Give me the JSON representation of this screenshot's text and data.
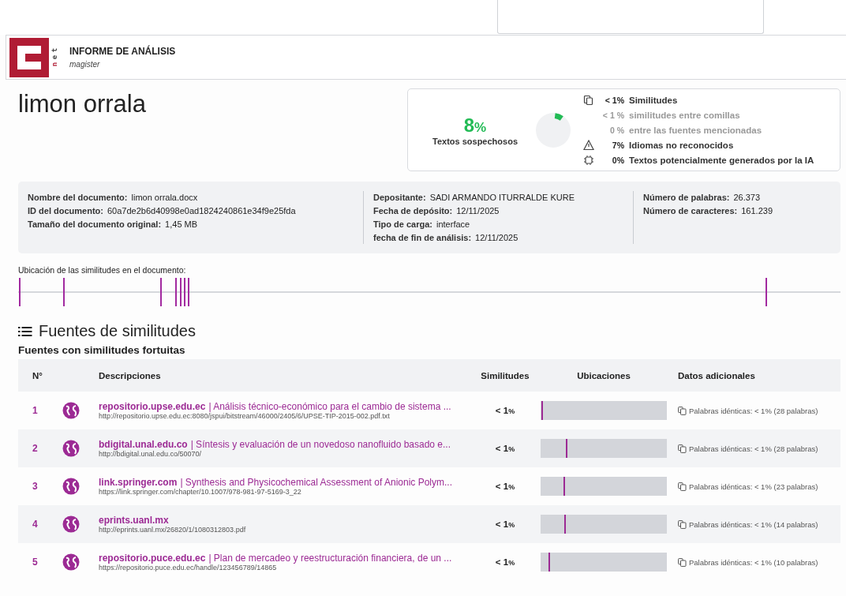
{
  "header": {
    "title": "INFORME DE ANÁLISIS",
    "subtitle": "magister",
    "logo_letters": "net"
  },
  "document_title": "limon orrala",
  "summary": {
    "percent": "8",
    "percent_sign": "%",
    "label": "Textos sospechosos",
    "lines": [
      {
        "kind": "similarity",
        "value": "< 1%",
        "label": "Similitudes"
      },
      {
        "kind": "sub",
        "value": "< 1 %",
        "label": "similitudes entre comillas"
      },
      {
        "kind": "sub",
        "value": "0 %",
        "label": "entre las fuentes mencionadas"
      },
      {
        "kind": "language",
        "value": "7%",
        "label": "Idiomas no reconocidos"
      },
      {
        "kind": "ai",
        "value": "0%",
        "label": "Textos potencialmente generados por la IA"
      }
    ]
  },
  "details": [
    [
      {
        "label": "Nombre del documento:",
        "value": "limon orrala.docx"
      },
      {
        "label": "ID del documento:",
        "value": "60a7de2b6d40998e0ad1824240861e34f9e25fda"
      },
      {
        "label": "Tamaño del documento original:",
        "value": "1,45 MB"
      }
    ],
    [
      {
        "label": "Depositante:",
        "value": "SADI ARMANDO ITURRALDE KURE"
      },
      {
        "label": "Fecha de depósito:",
        "value": "12/11/2025"
      },
      {
        "label": "Tipo de carga:",
        "value": "interface"
      },
      {
        "label": "fecha de fin de análisis:",
        "value": "12/11/2025"
      }
    ],
    [
      {
        "label": "Número de palabras:",
        "value": "26.373"
      },
      {
        "label": "Número de caracteres:",
        "value": "161.239"
      }
    ]
  ],
  "locations": {
    "title": "Ubicación de las similitudes en el documento:",
    "markers": [
      {
        "level": 0.001
      },
      {
        "level": 0.055
      },
      {
        "level": 0.173
      },
      {
        "level": 0.191
      },
      {
        "level": 0.197
      },
      {
        "level": 0.202
      },
      {
        "level": 0.206
      },
      {
        "level": 0.909
      }
    ]
  },
  "sources": {
    "title": "Fuentes de similitudes",
    "subtitle": "Fuentes con similitudes fortuitas",
    "columns": [
      "N°",
      "Descripciones",
      "Similitudes",
      "Ubicaciones",
      "Datos adicionales"
    ],
    "rows": [
      {
        "number": "1",
        "site": "repositorio.upse.edu.ec",
        "description": "| Análisis técnico-económico para el cambio de sistema ...",
        "url": "http://repositorio.upse.edu.ec:8080/jspui/bitstream/46000/2405/6/UPSE-TIP-2015-002.pdf.txt",
        "similarity": "< 1",
        "sim_sign": "%",
        "location": {
          "level": 0.005
        },
        "extra": "Palabras idénticas: < 1% (28 palabras)"
      },
      {
        "number": "2",
        "site": "bdigital.unal.edu.co",
        "description": "| Síntesis y evaluación de un novedoso nanofluido basado e...",
        "url": "http://bdigital.unal.edu.co/50070/",
        "similarity": "< 1",
        "sim_sign": "%",
        "location": {
          "level": 0.2
        },
        "extra": "Palabras idénticas: < 1% (28 palabras)"
      },
      {
        "number": "3",
        "site": "link.springer.com",
        "description": "| Synthesis and Physicochemical Assessment of Anionic Polym...",
        "url": "https://link.springer.com/chapter/10.1007/978-981-97-5169-3_22",
        "similarity": "< 1",
        "sim_sign": "%",
        "location": {
          "level": 0.18
        },
        "extra": "Palabras idénticas: < 1% (23 palabras)"
      },
      {
        "number": "4",
        "site": "eprints.uanl.mx",
        "url": "http://eprints.uanl.mx/26820/1/1080312803.pdf",
        "similarity": "< 1",
        "sim_sign": "%",
        "location": {
          "level": 0.19
        },
        "extra": "Palabras idénticas: < 1% (14 palabras)"
      },
      {
        "number": "5",
        "site": "repositorio.puce.edu.ec",
        "description": "| Plan de mercadeo y reestructuración financiera, de un ...",
        "url": "https://repositorio.puce.edu.ec/handle/123456789/14865",
        "similarity": "< 1",
        "sim_sign": "%",
        "location": {
          "level": 0.06
        },
        "extra": "Palabras idénticas: < 1% (10 palabras)"
      }
    ]
  }
}
